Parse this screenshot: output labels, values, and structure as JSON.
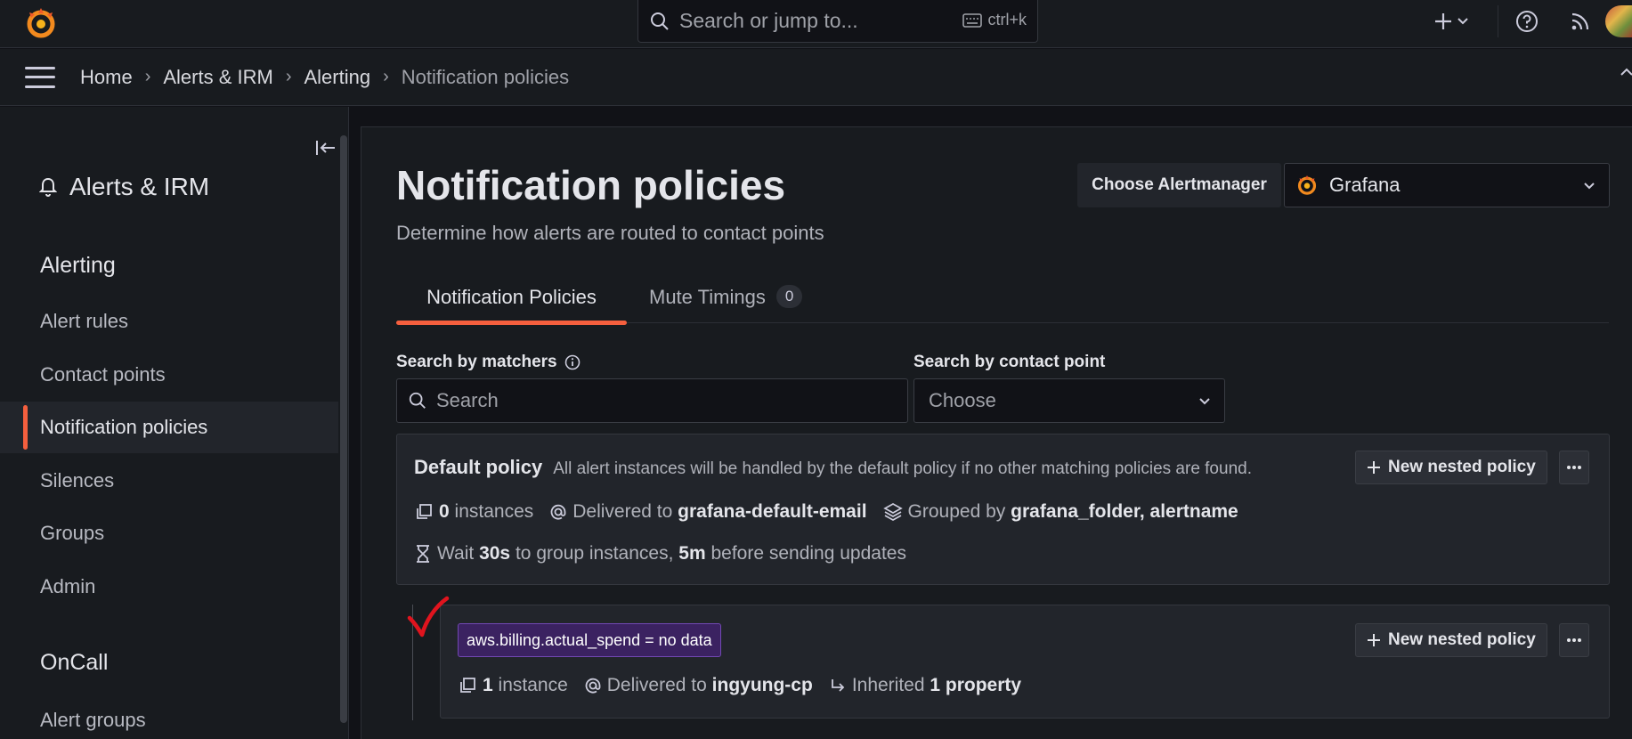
{
  "topbar": {
    "search_placeholder": "Search or jump to...",
    "shortcut": "ctrl+k",
    "icons": [
      "grafana-logo-icon",
      "search-icon",
      "keyboard-icon",
      "plus-icon",
      "chevron-down-icon",
      "help-icon",
      "rss-icon",
      "avatar"
    ]
  },
  "breadcrumb": {
    "items": [
      "Home",
      "Alerts & IRM",
      "Alerting"
    ],
    "current": "Notification policies",
    "separator": "›"
  },
  "sidebar": {
    "title": "Alerts & IRM",
    "section_alerting": "Alerting",
    "items": [
      "Alert rules",
      "Contact points",
      "Notification policies",
      "Silences",
      "Groups",
      "Admin"
    ],
    "active_item": "Notification policies",
    "section_oncall": "OnCall",
    "oncall_items": [
      "Alert groups"
    ]
  },
  "page": {
    "title": "Notification policies",
    "subtitle": "Determine how alerts are routed to contact points",
    "alertmanager_label": "Choose Alertmanager",
    "alertmanager_value": "Grafana"
  },
  "tabs": {
    "notification_policies": "Notification Policies",
    "mute_timings": "Mute Timings",
    "mute_timings_count": "0"
  },
  "filters": {
    "matchers_label": "Search by matchers",
    "matchers_placeholder": "Search",
    "contact_point_label": "Search by contact point",
    "contact_point_placeholder": "Choose"
  },
  "default_policy": {
    "name": "Default policy",
    "description": "All alert instances will be handled by the default policy if no other matching policies are found.",
    "new_nested_label": "New nested policy",
    "instances_count": "0",
    "instances_label": "instances",
    "delivered_label": "Delivered to",
    "contact_point": "grafana-default-email",
    "grouped_label": "Grouped by",
    "grouped_by": "grafana_folder, alertname",
    "wait_label": "Wait",
    "wait_value": "30s",
    "wait_mid": "to group instances,",
    "repeat_value": "5m",
    "repeat_label": "before sending updates"
  },
  "nested_policy": {
    "matcher": "aws.billing.actual_spend = no data",
    "new_nested_label": "New nested policy",
    "instances_count": "1",
    "instances_label": "instance",
    "delivered_label": "Delivered to",
    "contact_point": "ingyung-cp",
    "inherited_label": "Inherited",
    "inherited_value": "1 property"
  },
  "colors": {
    "accent": "#f55f3e",
    "matcher_bg": "#3b2261",
    "annotation": "#e0141e"
  }
}
